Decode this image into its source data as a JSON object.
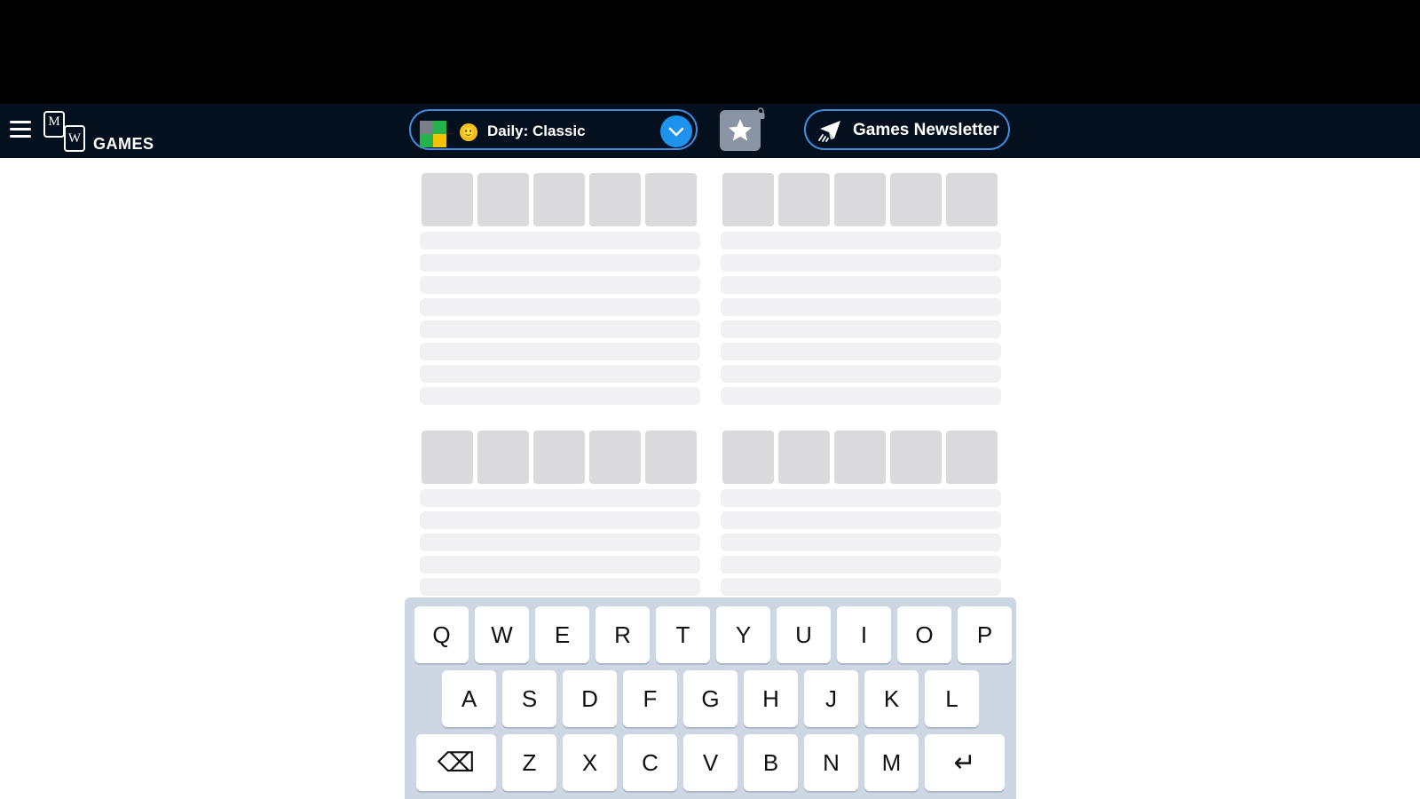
{
  "header": {
    "logo": {
      "m": "M",
      "w": "W",
      "text": "GAMES"
    },
    "mode_select": {
      "label": "Daily: Classic",
      "emoji": "🙂"
    },
    "newsletter_label": "Games Newsletter"
  },
  "boards_count": 4,
  "keyboard": {
    "rows": [
      [
        "Q",
        "W",
        "E",
        "R",
        "T",
        "Y",
        "U",
        "I",
        "O",
        "P"
      ],
      [
        "A",
        "S",
        "D",
        "F",
        "G",
        "H",
        "J",
        "K",
        "L"
      ],
      [
        "⌫",
        "Z",
        "X",
        "C",
        "V",
        "B",
        "N",
        "M",
        "↵"
      ]
    ]
  },
  "colors": {
    "navbar": "#05101f",
    "accent_blue": "#1d93ee",
    "tile_placeholder": "#dadadd",
    "keyboard_bg": "#cdd7e3"
  }
}
